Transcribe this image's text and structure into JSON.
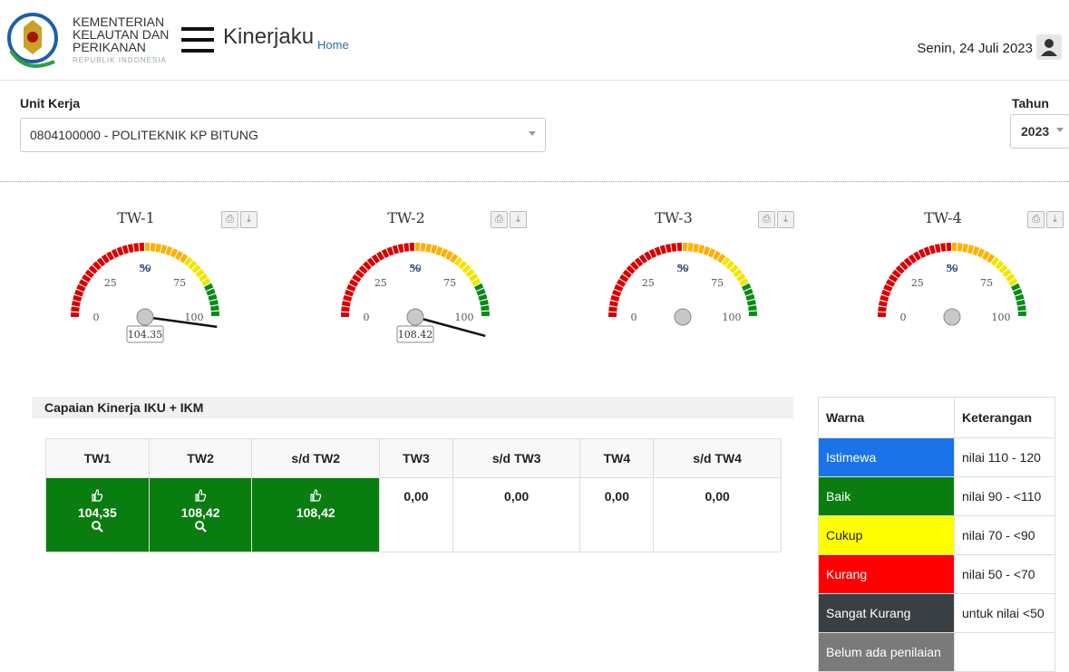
{
  "header": {
    "ministry_line1": "KEMENTERIAN",
    "ministry_line2": "KELAUTAN DAN",
    "ministry_line3": "PERIKANAN",
    "ministry_sub": "REPUBLIK INDONESIA",
    "app_title": "Kinerjaku",
    "home_link": "Home",
    "date": "Senin, 24 Juli 2023"
  },
  "filters": {
    "unit_label": "Unit Kerja",
    "unit_value": "0804100000 - POLITEKNIK KP BITUNG",
    "year_label": "Tahun",
    "year_value": "2023"
  },
  "gauges": [
    {
      "title": "TW-1",
      "value": 104.35,
      "value_text": "104.35"
    },
    {
      "title": "TW-2",
      "value": 108.42,
      "value_text": "108.42"
    },
    {
      "title": "TW-3",
      "value": null,
      "value_text": ""
    },
    {
      "title": "TW-4",
      "value": null,
      "value_text": ""
    }
  ],
  "gauge_ticks": [
    "0",
    "25",
    "50",
    "75",
    "100"
  ],
  "gauge_unit": "%",
  "section_title": "Capaian Kinerja IKU + IKM",
  "perf_table": {
    "headers": [
      "TW1",
      "TW2",
      "s/d TW2",
      "TW3",
      "s/d TW3",
      "TW4",
      "s/d TW4"
    ],
    "values": [
      "104,35",
      "108,42",
      "108,42",
      "0,00",
      "0,00",
      "0,00",
      "0,00"
    ]
  },
  "legend": {
    "col_color": "Warna",
    "col_desc": "Keterangan",
    "rows": [
      {
        "label": "Istimewa",
        "desc": "nilai 110 - 120",
        "color": "#1a73e8"
      },
      {
        "label": "Baik",
        "desc": "nilai 90 - <110",
        "color": "#0a7d10"
      },
      {
        "label": "Cukup",
        "desc": "nilai 70 - <90",
        "color": "#ffff00"
      },
      {
        "label": "Kurang",
        "desc": "nilai 50 - <70",
        "color": "#ff0000"
      },
      {
        "label": "Sangat Kurang",
        "desc": "untuk nilai <50",
        "color": "#3a3f44"
      },
      {
        "label": "Belum ada penilaian",
        "desc": "",
        "color": "#7a7a7a"
      }
    ]
  },
  "icons": {
    "gauge_print": "print-icon",
    "gauge_download": "download-icon",
    "thumb": "thumbs-up-icon",
    "search": "search-icon",
    "user": "user-icon",
    "menu": "hamburger-menu-icon"
  }
}
